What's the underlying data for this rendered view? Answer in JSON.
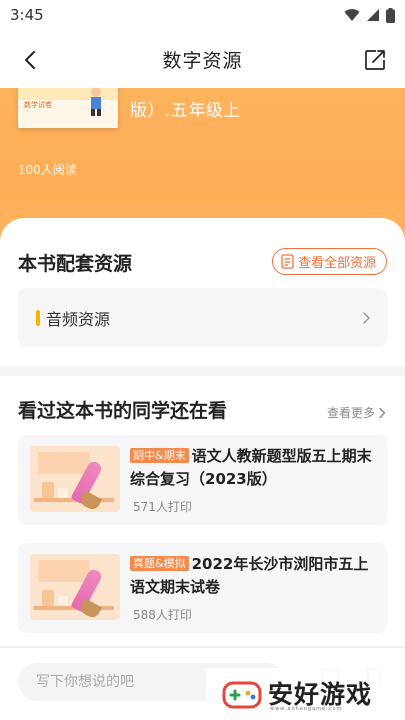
{
  "status_bar": {
    "time": "3:45"
  },
  "nav": {
    "title": "数字资源"
  },
  "book": {
    "title_fragment": "版）.五年级上",
    "reads": "100人阅读",
    "cover_text": "数学试卷"
  },
  "resources": {
    "title": "本书配套资源",
    "view_all_label": "查看全部资源",
    "items": [
      {
        "label": "音频资源"
      }
    ]
  },
  "recommend": {
    "title": "看过这本书的同学还在看",
    "more_label": "查看更多",
    "items": [
      {
        "tag": "期中&期末",
        "title": "语文人教新题型版五上期末综合复习（2023版）",
        "reads": "571人打印"
      },
      {
        "tag": "真题&模拟",
        "title": "2022年长沙市浏阳市五上语文期末试卷",
        "reads": "588人打印"
      }
    ]
  },
  "comment": {
    "placeholder": "写下你想说的吧"
  },
  "watermark": {
    "text": "安好游戏",
    "sub": "www.anhaogame.com"
  },
  "colors": {
    "accent": "#f2703a",
    "hero": "#ffae55",
    "tag": "#f58a4e",
    "audio_marker": "#fcb300"
  }
}
